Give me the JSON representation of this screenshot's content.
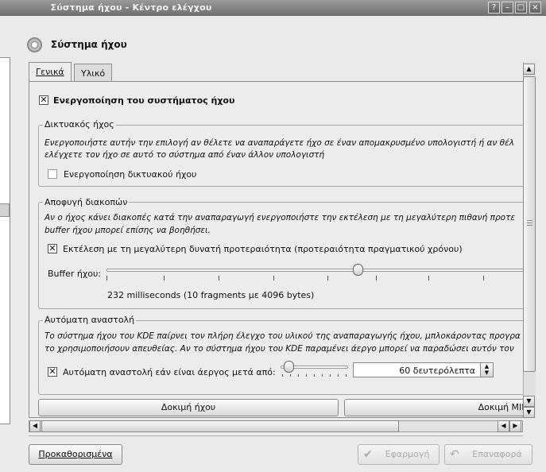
{
  "window": {
    "title": "Σύστημα ήχου - Κέντρο ελέγχου",
    "controls": {
      "help": "?",
      "minimize": "–",
      "maximize": "□",
      "close": "×"
    }
  },
  "header": {
    "title": "Σύστημα ήχου",
    "icon": "speaker-icon"
  },
  "tabs": [
    {
      "label": "Γενικά",
      "active": true
    },
    {
      "label": "Υλικό",
      "active": false
    }
  ],
  "general": {
    "enable_sound_system": {
      "label": "Ενεργοποίηση του συστήματος ήχου",
      "checked": true
    },
    "network_sound": {
      "title": "Δικτυακός ήχος",
      "description_line1": "Ενεργοποιήστε αυτήν την επιλογή αν θέλετε να αναπαράγετε ήχο σε έναν απομακρυσμένο υπολογιστή ή αν θέλ",
      "description_line2": "ελέγχετε τον ήχο σε αυτό το σύστημα από έναν άλλον υπολογιστή",
      "checkbox_label": "Ενεργοποίηση δικτυακού ήχου",
      "checked": false
    },
    "skip_avoidance": {
      "title": "Αποφυγή διακοπών",
      "description_line1": "Αν ο ήχος κάνει διακοπές κατά την αναπαραγωγή ενεργοποιήστε την εκτέλεση με τη μεγαλύτερη πιθανή προτε",
      "description_line2": "buffer ήχου μπορεί επίσης να βοηθήσει.",
      "checkbox_label": "Εκτέλεση με τη μεγαλύτερη δυνατή προτεραιότητα (προτεραιότητα πραγματικού χρόνου)",
      "checked": true,
      "buffer_label": "Buffer ήχου:",
      "buffer_value_text": "232 milliseconds (10 fragments με 4096 bytes)",
      "buffer_slider_fraction": 0.6
    },
    "auto_suspend": {
      "title": "Αυτόματη αναστολή",
      "description_line1": "Το σύστημα ήχου του KDE παίρνει τον πλήρη έλεγχο του υλικού της αναπαραγωγής ήχου, μπλοκάροντας προγρα",
      "description_line2": "το χρησιμοποιήσουν απευθείας. Αν το σύστημα ήχου του KDE παραμένει άεργο μπορεί να παραδώσει αυτόν τον",
      "checkbox_label": "Αυτόματη αναστολή εάν είναι άεργος μετά από:",
      "checked": true,
      "spin_value": "60 δευτερόλεπτα",
      "slider_fraction": 0.05
    },
    "test_sound_button": "Δοκιμή ήχου",
    "test_midi_button": "Δοκιμή MIDI"
  },
  "footer": {
    "defaults_button": "Προκαθορισμένα",
    "apply_button": "Εφαρμογή",
    "reset_button": "Επαναφορά"
  }
}
